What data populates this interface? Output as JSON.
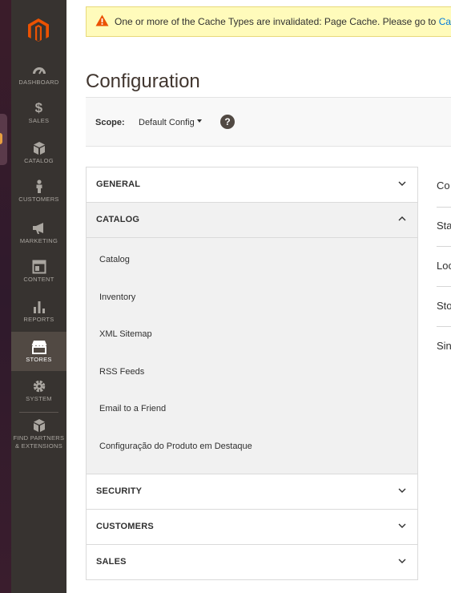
{
  "notice": {
    "text": "One or more of the Cache Types are invalidated: Page Cache. Please go to",
    "link": "Cache"
  },
  "page": {
    "title": "Configuration"
  },
  "scope": {
    "label": "Scope:",
    "value": "Default Config"
  },
  "sidebar": {
    "items": [
      {
        "label": "DASHBOARD",
        "icon": "dashboard-icon"
      },
      {
        "label": "SALES",
        "icon": "dollar-icon"
      },
      {
        "label": "CATALOG",
        "icon": "box-icon"
      },
      {
        "label": "CUSTOMERS",
        "icon": "person-icon"
      },
      {
        "label": "MARKETING",
        "icon": "megaphone-icon"
      },
      {
        "label": "CONTENT",
        "icon": "layout-icon"
      },
      {
        "label": "REPORTS",
        "icon": "bar-chart-icon"
      },
      {
        "label": "STORES",
        "icon": "storefront-icon",
        "active": true
      },
      {
        "label": "SYSTEM",
        "icon": "gear-icon"
      },
      {
        "label": "FIND PARTNERS",
        "label2": "& EXTENSIONS",
        "icon": "cubes-icon"
      }
    ]
  },
  "tabs": [
    {
      "label": "GENERAL",
      "open": false
    },
    {
      "label": "CATALOG",
      "open": true,
      "items": [
        "Catalog",
        "Inventory",
        "XML Sitemap",
        "RSS Feeds",
        "Email to a Friend",
        "Configuração do Produto em Destaque"
      ]
    },
    {
      "label": "SECURITY",
      "open": false
    },
    {
      "label": "CUSTOMERS",
      "open": false
    },
    {
      "label": "SALES",
      "open": false
    }
  ],
  "fields": [
    "Co",
    "Sta",
    "Loc",
    "Sto",
    "Sin"
  ],
  "colors": {
    "sidebar": "#373330",
    "accent": "#eb5202",
    "link": "#007bdb",
    "notice_bg": "#fffbbb"
  }
}
